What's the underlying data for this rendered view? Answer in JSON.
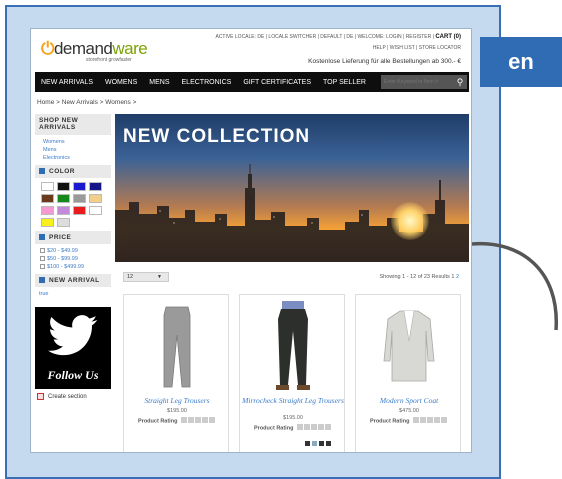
{
  "lang_badge": "en",
  "header": {
    "logo_prefix": "demand",
    "logo_suffix": "ware",
    "tagline": "storefront growfaster",
    "toplinks": "ACTIVE LOCALE: DE | LOCALE SWITCHER | DEFAULT | DE | WELCOME: LOGIN | REGISTER |",
    "cart": "CART (0)",
    "toplinks2": "HELP | WISH LIST | STORE LOCATOR",
    "ship_note": "Kostenlose Lieferung für alle Bestellungen ab 300.- €"
  },
  "nav": {
    "items": [
      "NEW ARRIVALS",
      "WOMENS",
      "MENS",
      "ELECTRONICS",
      "GIFT CERTIFICATES",
      "TOP SELLER"
    ],
    "search_placeholder": "Enter Keyword or Item #"
  },
  "breadcrumb": "Home > New Arrivals > Womens >",
  "sidebar": {
    "shop_title": "SHOP NEW ARRIVALS",
    "shop_links": [
      "Womens",
      "Mens",
      "Electronics"
    ],
    "color_title": "COLOR",
    "swatch_colors": [
      "#ffffff",
      "#111111",
      "#1a1ad0",
      "#14148a",
      "#6b3a1c",
      "#138a1a",
      "#9a9a9a",
      "#f3cf8a",
      "#f59ad0",
      "#c28ad8",
      "#e81c1c",
      "#ffffff",
      "#f8f01a",
      "#dddddd"
    ],
    "price_title": "PRICE",
    "prices": [
      "$20 - $49.99",
      "$50 - $99.99",
      "$100 - $499.99"
    ],
    "new_arrival_title": "NEW ARRIVAL",
    "new_arrival_link": "true",
    "follow": "Follow Us",
    "create_section": "Create section"
  },
  "banner": {
    "title": "NEW COLLECTION"
  },
  "toolbar": {
    "per_page": "12",
    "showing": "Showing 1 - 12 of 23 Results",
    "page1": "1",
    "page2": "2"
  },
  "products": [
    {
      "name": "Straight Leg Trousers",
      "price": "$195.00",
      "rating_label": "Product Rating"
    },
    {
      "name": "Mirrocheck Straight Leg Trousers",
      "price": "$195.00",
      "rating_label": "Product Rating"
    },
    {
      "name": "Modern Sport Coat",
      "price": "$475.00",
      "rating_label": "Product Rating"
    }
  ],
  "colors": {
    "frame_bg": "#c5d9ef",
    "frame_border": "#3a6fb5",
    "badge": "#2f6cb3",
    "nav_bg": "#0e0e0e",
    "link": "#3b7bc7"
  }
}
